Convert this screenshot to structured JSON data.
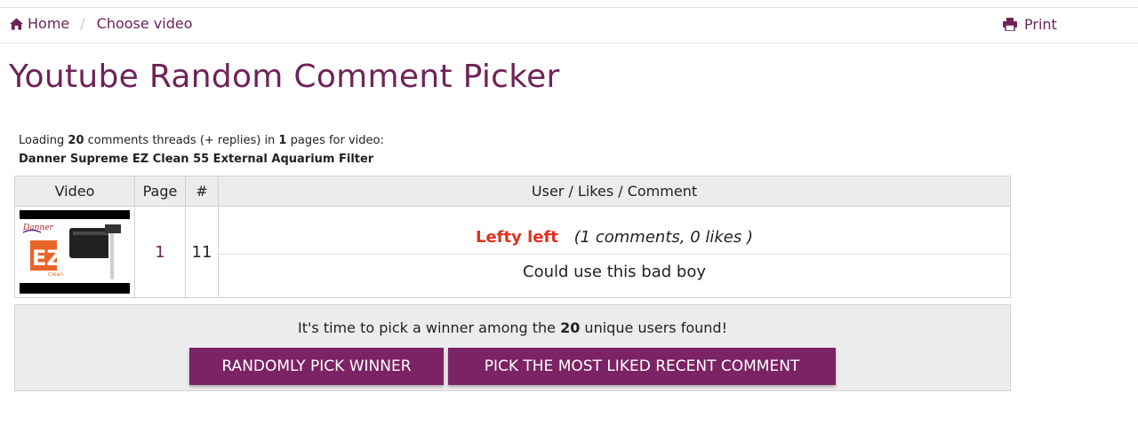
{
  "breadcrumb": {
    "home_label": "Home",
    "separator": "/",
    "current_label": "Choose video"
  },
  "header": {
    "print_label": "Print"
  },
  "page": {
    "title": "Youtube Random Comment Picker"
  },
  "loading": {
    "prefix": "Loading ",
    "threads_count": "20",
    "middle": " comments threads (+ replies) in ",
    "pages_count": "1",
    "suffix": " pages for video:",
    "video_title": "Danner Supreme EZ Clean 55 External Aquarium Filter"
  },
  "table": {
    "headers": {
      "video": "Video",
      "page": "Page",
      "number": "#",
      "comment": "User / Likes / Comment"
    },
    "rows": [
      {
        "page": "1",
        "number": "11",
        "username": "Lefty left",
        "stats": "(1 comments, 0 likes )",
        "comment": "Could use this bad boy"
      }
    ]
  },
  "winner": {
    "msg_prefix": "It's time to pick a winner among the ",
    "unique_users": "20",
    "msg_suffix": " unique users found!",
    "random_button": "RANDOMLY PICK WINNER",
    "liked_button": "PICK THE MOST LIKED RECENT COMMENT"
  },
  "icons": {
    "home": "home-icon",
    "print": "print-icon"
  },
  "colors": {
    "brand": "#6e2358",
    "button": "#7b2364",
    "username": "#e0301e",
    "panel_bg": "#ececec"
  }
}
